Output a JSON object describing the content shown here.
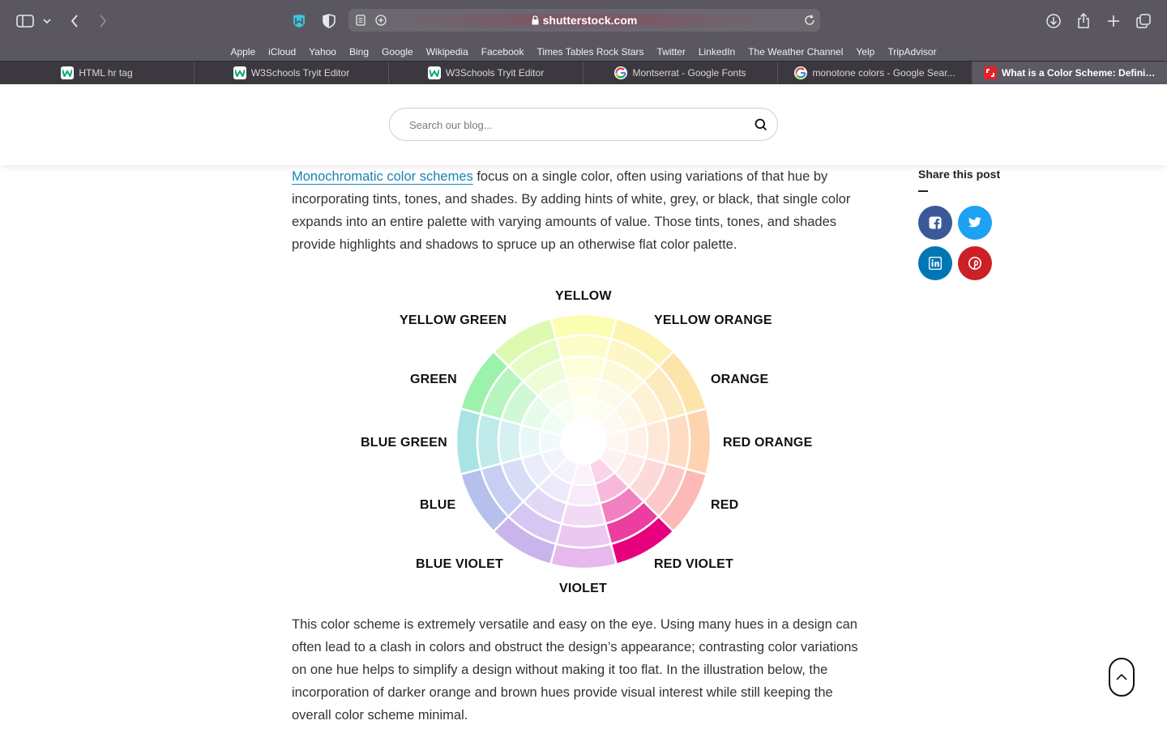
{
  "browser": {
    "url_host": "shutterstock.com",
    "bookmarks": [
      "Apple",
      "iCloud",
      "Yahoo",
      "Bing",
      "Google",
      "Wikipedia",
      "Facebook",
      "Times Tables Rock Stars",
      "Twitter",
      "LinkedIn",
      "The Weather Channel",
      "Yelp",
      "TripAdvisor"
    ],
    "tabs": [
      {
        "label": "HTML hr tag",
        "favicon": "w3schools-icon"
      },
      {
        "label": "W3Schools Tryit Editor",
        "favicon": "w3schools-icon"
      },
      {
        "label": "W3Schools Tryit Editor",
        "favicon": "w3schools-icon"
      },
      {
        "label": "Montserrat - Google Fonts",
        "favicon": "google-icon"
      },
      {
        "label": "monotone colors - Google Sear...",
        "favicon": "google-icon"
      },
      {
        "label": "What is a Color Scheme: Definit...",
        "favicon": "shutterstock-icon",
        "active": true
      }
    ]
  },
  "search": {
    "placeholder": "Search our blog..."
  },
  "article": {
    "para1_link": "Monochromatic color schemes",
    "para1_rest": " focus on a single color, often using variations of that hue by incorporating tints, tones, and shades. By adding hints of white, grey, or black, that single color expands into an entire palette with varying amounts of value. Those tints, tones, and shades provide highlights and shadows to spruce up an otherwise flat color palette.",
    "para2": "This color scheme is extremely versatile and easy on the eye. Using many hues in a design can often lead to a clash in colors and obstruct the design’s appearance; contrasting color variations on one hue helps to simplify a design without making it too flat. In the illustration below, the incorporation of darker orange and brown hues provide visual interest while still keeping the overall color scheme minimal."
  },
  "share": {
    "title": "Share this post",
    "buttons": [
      {
        "name": "facebook",
        "color": "#3b5998"
      },
      {
        "name": "twitter",
        "color": "#1da1f2"
      },
      {
        "name": "linkedin",
        "color": "#0077b5"
      },
      {
        "name": "pinterest",
        "color": "#cb2027"
      }
    ]
  },
  "color_wheel": {
    "labels": [
      "YELLOW",
      "YELLOW ORANGE",
      "ORANGE",
      "RED ORANGE",
      "RED",
      "RED VIOLET",
      "VIOLET",
      "BLUE VIOLET",
      "BLUE",
      "BLUE GREEN",
      "GREEN",
      "YELLOW GREEN"
    ],
    "segment_colors": [
      [
        "#fbfdb0",
        "#fcfdc6",
        "#fdfed9",
        "#fefee9"
      ],
      [
        "#fdf3b3",
        "#fdf6c7",
        "#fef9da",
        "#fefbea"
      ],
      [
        "#fde4aa",
        "#fdebc0",
        "#fef1d6",
        "#fef7e8"
      ],
      [
        "#fdd3b0",
        "#fddcc3",
        "#fee7d6",
        "#fef1e8"
      ],
      [
        "#fdb8b8",
        "#fdc8c8",
        "#fed9d9",
        "#fee8e8"
      ],
      [
        "#e6007e",
        "#ec3e9f",
        "#f27fbf",
        "#f8b8dc"
      ],
      [
        "#e6b8ec",
        "#ecc8f1",
        "#f2daf6",
        "#f8eafa"
      ],
      [
        "#c9b5ec",
        "#d6c6f1",
        "#e2d8f6",
        "#eee9fa"
      ],
      [
        "#b5c0ec",
        "#c6cef1",
        "#d8ddf6",
        "#e9ecfa"
      ],
      [
        "#a9e3e3",
        "#c0eaea",
        "#d6f1f1",
        "#e8f7f7"
      ],
      [
        "#9bf2ab",
        "#b6f5c0",
        "#cff8d6",
        "#e6fbea"
      ],
      [
        "#ddfab0",
        "#e5fbc4",
        "#eefcd8",
        "#f5fde9"
      ]
    ]
  }
}
